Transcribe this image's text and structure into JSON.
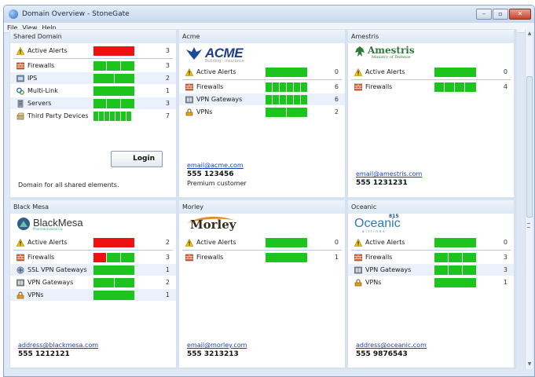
{
  "window": {
    "title": "Domain Overview - StoneGate"
  },
  "menu": [
    "File",
    "View",
    "Help"
  ],
  "shared": {
    "title": "Shared Domain",
    "rows": [
      {
        "label": "Active Alerts",
        "count": "3"
      },
      {
        "label": "Firewalls",
        "count": "3"
      },
      {
        "label": "IPS",
        "count": "2"
      },
      {
        "label": "Multi-Link",
        "count": "1"
      },
      {
        "label": "Servers",
        "count": "3"
      },
      {
        "label": "Third Party Devices",
        "count": "7"
      }
    ],
    "login_label": "Login",
    "description": "Domain for all shared elements."
  },
  "acme": {
    "title": "Acme",
    "logo_text": "ACME",
    "logo_tagline": "Building · Insurance",
    "rows": [
      {
        "label": "Active Alerts",
        "count": "0"
      },
      {
        "label": "Firewalls",
        "count": "6"
      },
      {
        "label": "VPN Gateways",
        "count": "6"
      },
      {
        "label": "VPNs",
        "count": "2"
      }
    ],
    "email": "email@acme.com",
    "phone": "555 123456",
    "note": "Premium customer"
  },
  "amestris": {
    "title": "Amestris",
    "logo_text": "Amestris",
    "logo_tagline": "Ministry of Defense",
    "rows": [
      {
        "label": "Active Alerts",
        "count": "0"
      },
      {
        "label": "Firewalls",
        "count": "4"
      }
    ],
    "email": "email@amestris.com",
    "phone": "555 1231231"
  },
  "blackmesa": {
    "title": "Black Mesa",
    "logo_text": "BlackMesa",
    "logo_tagline": "Pharmaceutical Co.",
    "rows": [
      {
        "label": "Active Alerts",
        "count": "2"
      },
      {
        "label": "Firewalls",
        "count": "3"
      },
      {
        "label": "SSL VPN Gateways",
        "count": "1"
      },
      {
        "label": "VPN Gateways",
        "count": "2"
      },
      {
        "label": "VPNs",
        "count": "1"
      }
    ],
    "email": "address@blackmesa.com",
    "phone": "555 1212121"
  },
  "morley": {
    "title": "Morley",
    "logo_text": "Morley",
    "rows": [
      {
        "label": "Active Alerts",
        "count": "0"
      },
      {
        "label": "Firewalls",
        "count": "1"
      }
    ],
    "email": "email@morley.com",
    "phone": "555 3213213"
  },
  "oceanic": {
    "title": "Oceanic",
    "logo_text": "Oceanic",
    "logo_badge": "815",
    "logo_tagline": "airlines",
    "rows": [
      {
        "label": "Active Alerts",
        "count": "0"
      },
      {
        "label": "Firewalls",
        "count": "3"
      },
      {
        "label": "VPN Gateways",
        "count": "3"
      },
      {
        "label": "VPNs",
        "count": "1"
      }
    ],
    "email": "address@oceanic.com",
    "phone": "555 9876543"
  },
  "colors": {
    "ok": "#1ec41e",
    "alert": "#ee1111",
    "link": "#1a3fbd"
  }
}
